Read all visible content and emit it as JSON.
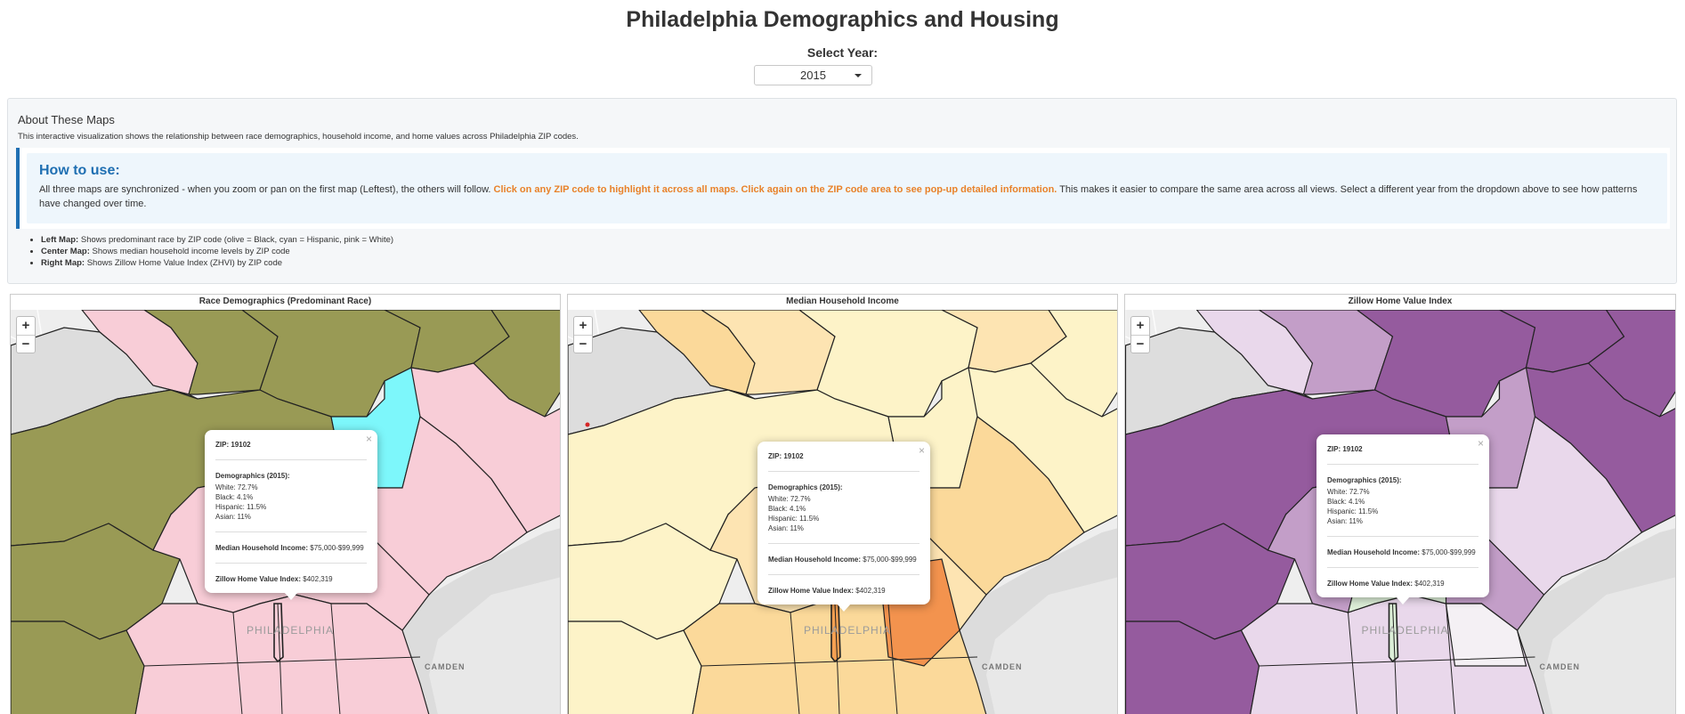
{
  "page": {
    "title": "Philadelphia Demographics and Housing",
    "year_label": "Select Year:",
    "year_value": "2015"
  },
  "about": {
    "title": "About These Maps",
    "text": "This interactive visualization shows the relationship between race demographics, household income, and home values across Philadelphia ZIP codes.",
    "howto_title": "How to use:",
    "howto_part1": "All three maps are synchronized - when you zoom or pan on the first map (Leftest), the others will follow. ",
    "howto_highlight": "Click on any ZIP code to highlight it across all maps. Click again on the ZIP code area to see pop-up detailed information.",
    "howto_part2": " This makes it easier to compare the same area across all views. Select a different year from the dropdown above to see how patterns have changed over time.",
    "legend": [
      {
        "label": "Left Map:",
        "text": " Shows predominant race by ZIP code (olive = Black, cyan = Hispanic, pink = White)"
      },
      {
        "label": "Center Map:",
        "text": " Shows median household income levels by ZIP code"
      },
      {
        "label": "Right Map:",
        "text": " Shows Zillow Home Value Index (ZHVI) by ZIP code"
      }
    ]
  },
  "panels": [
    {
      "title": "Race Demographics (Predominant Race)"
    },
    {
      "title": "Median Household Income"
    },
    {
      "title": "Zillow Home Value Index"
    }
  ],
  "zoom": {
    "plus": "+",
    "minus": "−"
  },
  "map_labels": {
    "city": "PHILADELPHIA",
    "camden": "CAMDEN"
  },
  "popup": {
    "close": "×",
    "zip_label": "ZIP:",
    "zip": "19102",
    "demographics_title": "Demographics (2015):",
    "white": "White: 72.7%",
    "black": "Black: 4.1%",
    "hispanic": "Hispanic: 11.5%",
    "asian": "Asian: 11%",
    "income_label": "Median Household Income:",
    "income_value": "$75,000-$99,999",
    "zhvi_label": "Zillow Home Value Index:",
    "zhvi_value": "$402,319"
  },
  "colors": {
    "black_olive": "#999a55",
    "hispanic_cyan": "#7df7fb",
    "white_pink": "#f8cdd7",
    "income_light": "#fdf3c8",
    "income_mid": "#fbd99a",
    "income_dark": "#f3934e",
    "zhvi_dark": "#955b9e",
    "zhvi_mid": "#c39ec8",
    "zhvi_light": "#e9d8eb"
  }
}
